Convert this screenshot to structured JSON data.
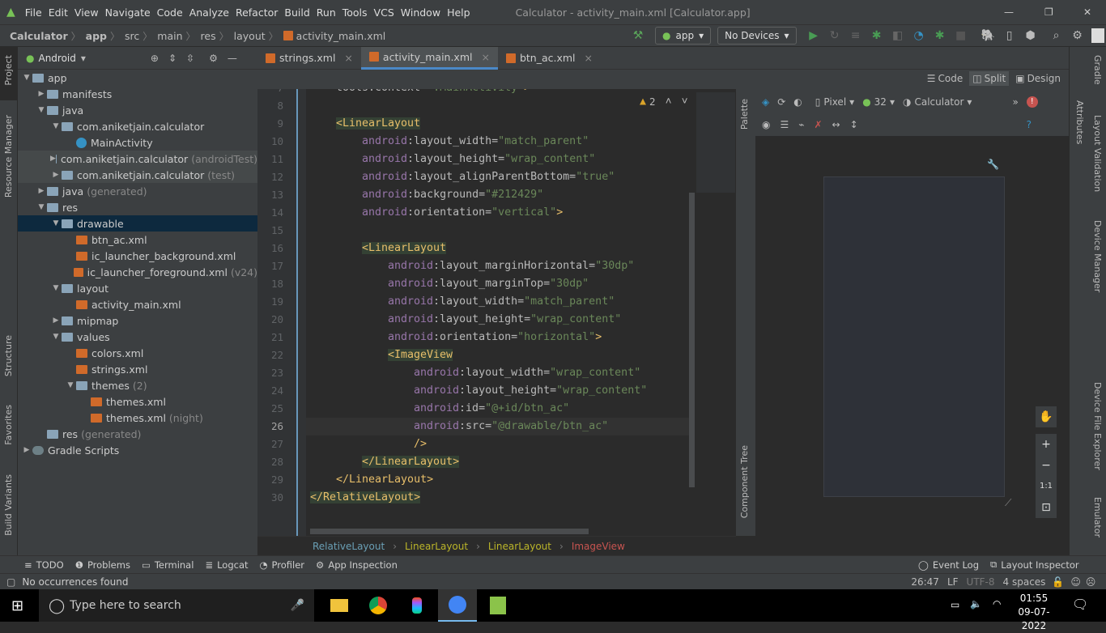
{
  "menu": {
    "items": [
      "File",
      "Edit",
      "View",
      "Navigate",
      "Code",
      "Analyze",
      "Refactor",
      "Build",
      "Run",
      "Tools",
      "VCS",
      "Window",
      "Help"
    ],
    "title": "Calculator - activity_main.xml [Calculator.app]"
  },
  "nav": {
    "crumbs": [
      "Calculator",
      "app",
      "src",
      "main",
      "res",
      "layout",
      "activity_main.xml"
    ],
    "config": "app",
    "device": "No Devices"
  },
  "project": {
    "view": "Android",
    "tree": [
      {
        "d": 0,
        "label": "app",
        "icon": "folder",
        "open": true
      },
      {
        "d": 1,
        "label": "manifests",
        "icon": "folder",
        "open": false
      },
      {
        "d": 1,
        "label": "java",
        "icon": "folder",
        "open": true
      },
      {
        "d": 2,
        "label": "com.aniketjain.calculator",
        "icon": "folder",
        "open": true
      },
      {
        "d": 3,
        "label": "MainActivity",
        "icon": "class"
      },
      {
        "d": 2,
        "label": "com.aniketjain.calculator",
        "suffix": "(androidTest)",
        "icon": "folder",
        "open": false,
        "test": true
      },
      {
        "d": 2,
        "label": "com.aniketjain.calculator",
        "suffix": "(test)",
        "icon": "folder",
        "open": false,
        "test": true
      },
      {
        "d": 1,
        "label": "java",
        "suffix": "(generated)",
        "icon": "folder",
        "open": false
      },
      {
        "d": 1,
        "label": "res",
        "icon": "folder",
        "open": true
      },
      {
        "d": 2,
        "label": "drawable",
        "icon": "folder",
        "open": true,
        "selected": true
      },
      {
        "d": 3,
        "label": "btn_ac.xml",
        "icon": "xml"
      },
      {
        "d": 3,
        "label": "ic_launcher_background.xml",
        "icon": "xml"
      },
      {
        "d": 3,
        "label": "ic_launcher_foreground.xml",
        "suffix": "(v24)",
        "icon": "xml"
      },
      {
        "d": 2,
        "label": "layout",
        "icon": "folder",
        "open": true
      },
      {
        "d": 3,
        "label": "activity_main.xml",
        "icon": "xml"
      },
      {
        "d": 2,
        "label": "mipmap",
        "icon": "folder",
        "open": false
      },
      {
        "d": 2,
        "label": "values",
        "icon": "folder",
        "open": true
      },
      {
        "d": 3,
        "label": "colors.xml",
        "icon": "xml"
      },
      {
        "d": 3,
        "label": "strings.xml",
        "icon": "xml"
      },
      {
        "d": 3,
        "label": "themes",
        "suffix": "(2)",
        "icon": "folder",
        "open": true
      },
      {
        "d": 4,
        "label": "themes.xml",
        "icon": "xml"
      },
      {
        "d": 4,
        "label": "themes.xml",
        "suffix": "(night)",
        "icon": "xml"
      },
      {
        "d": 1,
        "label": "res",
        "suffix": "(generated)",
        "icon": "folder"
      },
      {
        "d": 0,
        "label": "Gradle Scripts",
        "icon": "gradle",
        "open": false
      }
    ]
  },
  "left_stripe": [
    "Project",
    "Resource Manager",
    "Structure",
    "Favorites",
    "Build Variants"
  ],
  "tabs": [
    {
      "label": "strings.xml"
    },
    {
      "label": "activity_main.xml",
      "active": true
    },
    {
      "label": "btn_ac.xml"
    }
  ],
  "modes": [
    "Code",
    "Split",
    "Design"
  ],
  "warnings": "2",
  "code": [
    {
      "n": 7,
      "i": 1,
      "t": [
        [
          "at",
          "tools:context="
        ],
        [
          "val",
          "\".MainActivity\""
        ],
        [
          "pun",
          ">"
        ]
      ]
    },
    {
      "n": 8,
      "i": 0,
      "t": []
    },
    {
      "n": 9,
      "i": 1,
      "t": [
        [
          "tag",
          "<LinearLayout"
        ]
      ],
      "hl": true
    },
    {
      "n": 10,
      "i": 2,
      "t": [
        [
          "ns",
          "android"
        ],
        [
          "at",
          ":layout_width="
        ],
        [
          "val",
          "\"match_parent\""
        ]
      ]
    },
    {
      "n": 11,
      "i": 2,
      "t": [
        [
          "ns",
          "android"
        ],
        [
          "at",
          ":layout_height="
        ],
        [
          "val",
          "\"wrap_content\""
        ]
      ]
    },
    {
      "n": 12,
      "i": 2,
      "t": [
        [
          "ns",
          "android"
        ],
        [
          "at",
          ":layout_alignParentBottom="
        ],
        [
          "val",
          "\"true\""
        ]
      ]
    },
    {
      "n": 13,
      "i": 2,
      "t": [
        [
          "ns",
          "android"
        ],
        [
          "at",
          ":background="
        ],
        [
          "val",
          "\"#212429\""
        ]
      ]
    },
    {
      "n": 14,
      "i": 2,
      "t": [
        [
          "ns",
          "android"
        ],
        [
          "at",
          ":orientation="
        ],
        [
          "val",
          "\"vertical\""
        ],
        [
          "pun",
          ">"
        ]
      ]
    },
    {
      "n": 15,
      "i": 0,
      "t": []
    },
    {
      "n": 16,
      "i": 2,
      "t": [
        [
          "tag",
          "<LinearLayout"
        ]
      ],
      "hl": true
    },
    {
      "n": 17,
      "i": 3,
      "t": [
        [
          "ns",
          "android"
        ],
        [
          "at",
          ":layout_marginHorizontal="
        ],
        [
          "val",
          "\"30dp\""
        ]
      ]
    },
    {
      "n": 18,
      "i": 3,
      "t": [
        [
          "ns",
          "android"
        ],
        [
          "at",
          ":layout_marginTop="
        ],
        [
          "val",
          "\"30dp\""
        ]
      ]
    },
    {
      "n": 19,
      "i": 3,
      "t": [
        [
          "ns",
          "android"
        ],
        [
          "at",
          ":layout_width="
        ],
        [
          "val",
          "\"match_parent\""
        ]
      ]
    },
    {
      "n": 20,
      "i": 3,
      "t": [
        [
          "ns",
          "android"
        ],
        [
          "at",
          ":layout_height="
        ],
        [
          "val",
          "\"wrap_content\""
        ]
      ]
    },
    {
      "n": 21,
      "i": 3,
      "t": [
        [
          "ns",
          "android"
        ],
        [
          "at",
          ":orientation="
        ],
        [
          "val",
          "\"horizontal\""
        ],
        [
          "pun",
          ">"
        ]
      ]
    },
    {
      "n": 22,
      "i": 3,
      "t": [
        [
          "tag",
          "<ImageView"
        ]
      ],
      "hl": true
    },
    {
      "n": 23,
      "i": 4,
      "t": [
        [
          "ns",
          "android"
        ],
        [
          "at",
          ":layout_width="
        ],
        [
          "val",
          "\"wrap_content\""
        ]
      ]
    },
    {
      "n": 24,
      "i": 4,
      "t": [
        [
          "ns",
          "android"
        ],
        [
          "at",
          ":layout_height="
        ],
        [
          "val",
          "\"wrap_content\""
        ]
      ]
    },
    {
      "n": 25,
      "i": 4,
      "t": [
        [
          "ns",
          "android"
        ],
        [
          "at",
          ":id="
        ],
        [
          "val",
          "\"@+id/btn_ac\""
        ]
      ]
    },
    {
      "n": 26,
      "i": 4,
      "t": [
        [
          "ns",
          "android"
        ],
        [
          "at",
          ":src="
        ],
        [
          "val",
          "\"@drawable/btn_ac\""
        ]
      ],
      "cur": true
    },
    {
      "n": 27,
      "i": 4,
      "t": [
        [
          "tag",
          "/>"
        ]
      ]
    },
    {
      "n": 28,
      "i": 2,
      "t": [
        [
          "tag",
          "</LinearLayout>"
        ]
      ],
      "hl": true
    },
    {
      "n": 29,
      "i": 1,
      "t": [
        [
          "tag",
          "</LinearLayout>"
        ]
      ]
    },
    {
      "n": 30,
      "i": 0,
      "t": [
        [
          "tag",
          "</RelativeLayout>"
        ]
      ],
      "hl": true
    }
  ],
  "editor_breadcrumb": [
    "RelativeLayout",
    "LinearLayout",
    "LinearLayout",
    "ImageView"
  ],
  "palette": [
    "Palette",
    "Component Tree"
  ],
  "design_toolbar": {
    "device": "Pixel",
    "api": "32",
    "theme": "Calculator"
  },
  "zoom_controls": [
    "+",
    "−",
    "1:1"
  ],
  "right_stripe": [
    "Gradle",
    "Attributes",
    "Layout Validation",
    "Device Manager",
    "Device File Explorer",
    "Emulator"
  ],
  "bottom_tools": [
    "TODO",
    "Problems",
    "Terminal",
    "Logcat",
    "Profiler",
    "App Inspection"
  ],
  "bottom_right": [
    "Event Log",
    "Layout Inspector"
  ],
  "status": {
    "message": "No occurrences found",
    "position": "26:47",
    "line_sep": "LF",
    "encoding": "UTF-8",
    "indent": "4 spaces"
  },
  "taskbar": {
    "search_placeholder": "Type here to search",
    "time": "01:55",
    "date": "09-07-2022"
  }
}
